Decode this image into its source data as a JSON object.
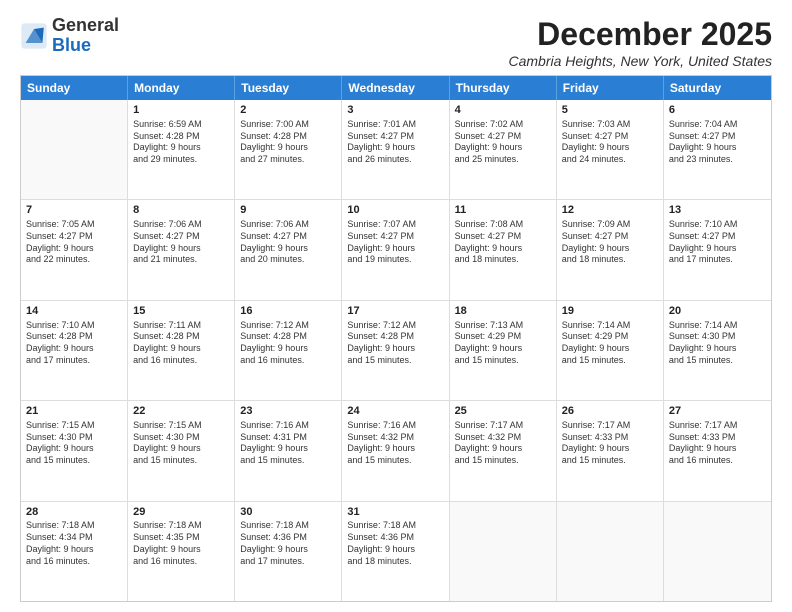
{
  "logo": {
    "general": "General",
    "blue": "Blue"
  },
  "title": "December 2025",
  "subtitle": "Cambria Heights, New York, United States",
  "days": [
    "Sunday",
    "Monday",
    "Tuesday",
    "Wednesday",
    "Thursday",
    "Friday",
    "Saturday"
  ],
  "weeks": [
    [
      {
        "day": "",
        "sunrise": "",
        "sunset": "",
        "daylight": "",
        "empty": true
      },
      {
        "day": "1",
        "sunrise": "Sunrise: 6:59 AM",
        "sunset": "Sunset: 4:28 PM",
        "daylight": "Daylight: 9 hours and 29 minutes.",
        "empty": false
      },
      {
        "day": "2",
        "sunrise": "Sunrise: 7:00 AM",
        "sunset": "Sunset: 4:28 PM",
        "daylight": "Daylight: 9 hours and 27 minutes.",
        "empty": false
      },
      {
        "day": "3",
        "sunrise": "Sunrise: 7:01 AM",
        "sunset": "Sunset: 4:27 PM",
        "daylight": "Daylight: 9 hours and 26 minutes.",
        "empty": false
      },
      {
        "day": "4",
        "sunrise": "Sunrise: 7:02 AM",
        "sunset": "Sunset: 4:27 PM",
        "daylight": "Daylight: 9 hours and 25 minutes.",
        "empty": false
      },
      {
        "day": "5",
        "sunrise": "Sunrise: 7:03 AM",
        "sunset": "Sunset: 4:27 PM",
        "daylight": "Daylight: 9 hours and 24 minutes.",
        "empty": false
      },
      {
        "day": "6",
        "sunrise": "Sunrise: 7:04 AM",
        "sunset": "Sunset: 4:27 PM",
        "daylight": "Daylight: 9 hours and 23 minutes.",
        "empty": false
      }
    ],
    [
      {
        "day": "7",
        "sunrise": "Sunrise: 7:05 AM",
        "sunset": "Sunset: 4:27 PM",
        "daylight": "Daylight: 9 hours and 22 minutes.",
        "empty": false
      },
      {
        "day": "8",
        "sunrise": "Sunrise: 7:06 AM",
        "sunset": "Sunset: 4:27 PM",
        "daylight": "Daylight: 9 hours and 21 minutes.",
        "empty": false
      },
      {
        "day": "9",
        "sunrise": "Sunrise: 7:06 AM",
        "sunset": "Sunset: 4:27 PM",
        "daylight": "Daylight: 9 hours and 20 minutes.",
        "empty": false
      },
      {
        "day": "10",
        "sunrise": "Sunrise: 7:07 AM",
        "sunset": "Sunset: 4:27 PM",
        "daylight": "Daylight: 9 hours and 19 minutes.",
        "empty": false
      },
      {
        "day": "11",
        "sunrise": "Sunrise: 7:08 AM",
        "sunset": "Sunset: 4:27 PM",
        "daylight": "Daylight: 9 hours and 18 minutes.",
        "empty": false
      },
      {
        "day": "12",
        "sunrise": "Sunrise: 7:09 AM",
        "sunset": "Sunset: 4:27 PM",
        "daylight": "Daylight: 9 hours and 18 minutes.",
        "empty": false
      },
      {
        "day": "13",
        "sunrise": "Sunrise: 7:10 AM",
        "sunset": "Sunset: 4:27 PM",
        "daylight": "Daylight: 9 hours and 17 minutes.",
        "empty": false
      }
    ],
    [
      {
        "day": "14",
        "sunrise": "Sunrise: 7:10 AM",
        "sunset": "Sunset: 4:28 PM",
        "daylight": "Daylight: 9 hours and 17 minutes.",
        "empty": false
      },
      {
        "day": "15",
        "sunrise": "Sunrise: 7:11 AM",
        "sunset": "Sunset: 4:28 PM",
        "daylight": "Daylight: 9 hours and 16 minutes.",
        "empty": false
      },
      {
        "day": "16",
        "sunrise": "Sunrise: 7:12 AM",
        "sunset": "Sunset: 4:28 PM",
        "daylight": "Daylight: 9 hours and 16 minutes.",
        "empty": false
      },
      {
        "day": "17",
        "sunrise": "Sunrise: 7:12 AM",
        "sunset": "Sunset: 4:28 PM",
        "daylight": "Daylight: 9 hours and 15 minutes.",
        "empty": false
      },
      {
        "day": "18",
        "sunrise": "Sunrise: 7:13 AM",
        "sunset": "Sunset: 4:29 PM",
        "daylight": "Daylight: 9 hours and 15 minutes.",
        "empty": false
      },
      {
        "day": "19",
        "sunrise": "Sunrise: 7:14 AM",
        "sunset": "Sunset: 4:29 PM",
        "daylight": "Daylight: 9 hours and 15 minutes.",
        "empty": false
      },
      {
        "day": "20",
        "sunrise": "Sunrise: 7:14 AM",
        "sunset": "Sunset: 4:30 PM",
        "daylight": "Daylight: 9 hours and 15 minutes.",
        "empty": false
      }
    ],
    [
      {
        "day": "21",
        "sunrise": "Sunrise: 7:15 AM",
        "sunset": "Sunset: 4:30 PM",
        "daylight": "Daylight: 9 hours and 15 minutes.",
        "empty": false
      },
      {
        "day": "22",
        "sunrise": "Sunrise: 7:15 AM",
        "sunset": "Sunset: 4:30 PM",
        "daylight": "Daylight: 9 hours and 15 minutes.",
        "empty": false
      },
      {
        "day": "23",
        "sunrise": "Sunrise: 7:16 AM",
        "sunset": "Sunset: 4:31 PM",
        "daylight": "Daylight: 9 hours and 15 minutes.",
        "empty": false
      },
      {
        "day": "24",
        "sunrise": "Sunrise: 7:16 AM",
        "sunset": "Sunset: 4:32 PM",
        "daylight": "Daylight: 9 hours and 15 minutes.",
        "empty": false
      },
      {
        "day": "25",
        "sunrise": "Sunrise: 7:17 AM",
        "sunset": "Sunset: 4:32 PM",
        "daylight": "Daylight: 9 hours and 15 minutes.",
        "empty": false
      },
      {
        "day": "26",
        "sunrise": "Sunrise: 7:17 AM",
        "sunset": "Sunset: 4:33 PM",
        "daylight": "Daylight: 9 hours and 15 minutes.",
        "empty": false
      },
      {
        "day": "27",
        "sunrise": "Sunrise: 7:17 AM",
        "sunset": "Sunset: 4:33 PM",
        "daylight": "Daylight: 9 hours and 16 minutes.",
        "empty": false
      }
    ],
    [
      {
        "day": "28",
        "sunrise": "Sunrise: 7:18 AM",
        "sunset": "Sunset: 4:34 PM",
        "daylight": "Daylight: 9 hours and 16 minutes.",
        "empty": false
      },
      {
        "day": "29",
        "sunrise": "Sunrise: 7:18 AM",
        "sunset": "Sunset: 4:35 PM",
        "daylight": "Daylight: 9 hours and 16 minutes.",
        "empty": false
      },
      {
        "day": "30",
        "sunrise": "Sunrise: 7:18 AM",
        "sunset": "Sunset: 4:36 PM",
        "daylight": "Daylight: 9 hours and 17 minutes.",
        "empty": false
      },
      {
        "day": "31",
        "sunrise": "Sunrise: 7:18 AM",
        "sunset": "Sunset: 4:36 PM",
        "daylight": "Daylight: 9 hours and 18 minutes.",
        "empty": false
      },
      {
        "day": "",
        "sunrise": "",
        "sunset": "",
        "daylight": "",
        "empty": true
      },
      {
        "day": "",
        "sunrise": "",
        "sunset": "",
        "daylight": "",
        "empty": true
      },
      {
        "day": "",
        "sunrise": "",
        "sunset": "",
        "daylight": "",
        "empty": true
      }
    ]
  ]
}
